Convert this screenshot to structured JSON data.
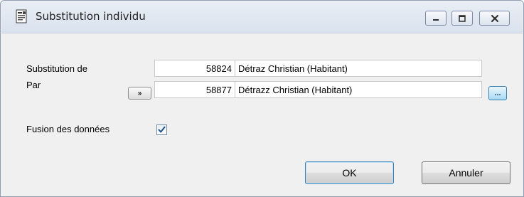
{
  "window": {
    "title": "Substitution individu",
    "title_icon": "document-icon",
    "caption_buttons": [
      "minimize",
      "maximize",
      "close"
    ]
  },
  "form": {
    "substitution_label": "Substitution de",
    "par_label": "Par",
    "from_number": "58824",
    "from_name": "Détraz Christian (Habitant)",
    "to_number": "58877",
    "to_name": "Détrazz Christian (Habitant)",
    "copy_button_label": "»",
    "browse_button_label": "...",
    "fusion_label": "Fusion des données",
    "fusion_checked": true
  },
  "buttons": {
    "ok": "OK",
    "cancel": "Annuler"
  },
  "colors": {
    "accent": "#3c7fb1",
    "window_bg": "#f0f0f0"
  }
}
